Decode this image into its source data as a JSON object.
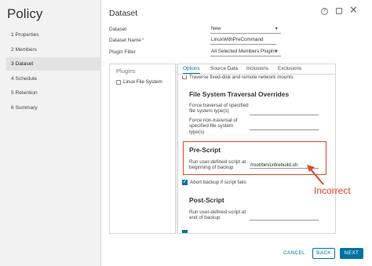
{
  "wizard": {
    "title": "Policy",
    "steps": [
      {
        "label": "1  Properties"
      },
      {
        "label": "2  Members"
      },
      {
        "label": "3  Dataset"
      },
      {
        "label": "4  Schedule"
      },
      {
        "label": "5  Retention"
      },
      {
        "label": "6  Summary"
      }
    ],
    "active_step": 2
  },
  "dialog": {
    "title": "Dataset",
    "help_icon": "?",
    "close_icon": "✕"
  },
  "form": {
    "dataset_label": "Dataset",
    "dataset_value": "New",
    "dataset_name_label": "Dataset Name",
    "dataset_name_required": "*",
    "dataset_name_value": "LinuxWithPreCommand",
    "plugin_filter_label": "Plugin Filter",
    "plugin_filter_value": "All Selected Members Plugins"
  },
  "plugins": {
    "heading": "Plugins",
    "items": [
      {
        "label": "Linux File System"
      }
    ]
  },
  "options": {
    "tabs": [
      {
        "label": "Options"
      },
      {
        "label": "Source Data"
      },
      {
        "label": "Inclusions"
      },
      {
        "label": "Exclusions"
      }
    ],
    "cut_off_label": "Traverse fixed-disk and remote network mounts",
    "fs_overrides": {
      "title": "File System Traversal Overrides",
      "force_traversal_label": "Force traversal of specified file system type(s)",
      "force_non_traversal_label": "Force non-traversal of specified file system type(s)"
    },
    "pre_script": {
      "title": "Pre-Script",
      "run_label": "Run user-defined script at beginning of backup",
      "run_value": "/root/bin/critrebuild.sh"
    },
    "abort_label": "Abort backup if script fails",
    "post_script": {
      "title": "Post-Script",
      "run_label": "Run user-defined script at end of backup"
    }
  },
  "annotation": {
    "text": "Incorrect",
    "color": "#e2452b"
  },
  "footer": {
    "cancel": "CANCEL",
    "back": "BACK",
    "next": "NEXT"
  },
  "colors": {
    "accent": "#0072a3",
    "annotation": "#e2452b"
  }
}
